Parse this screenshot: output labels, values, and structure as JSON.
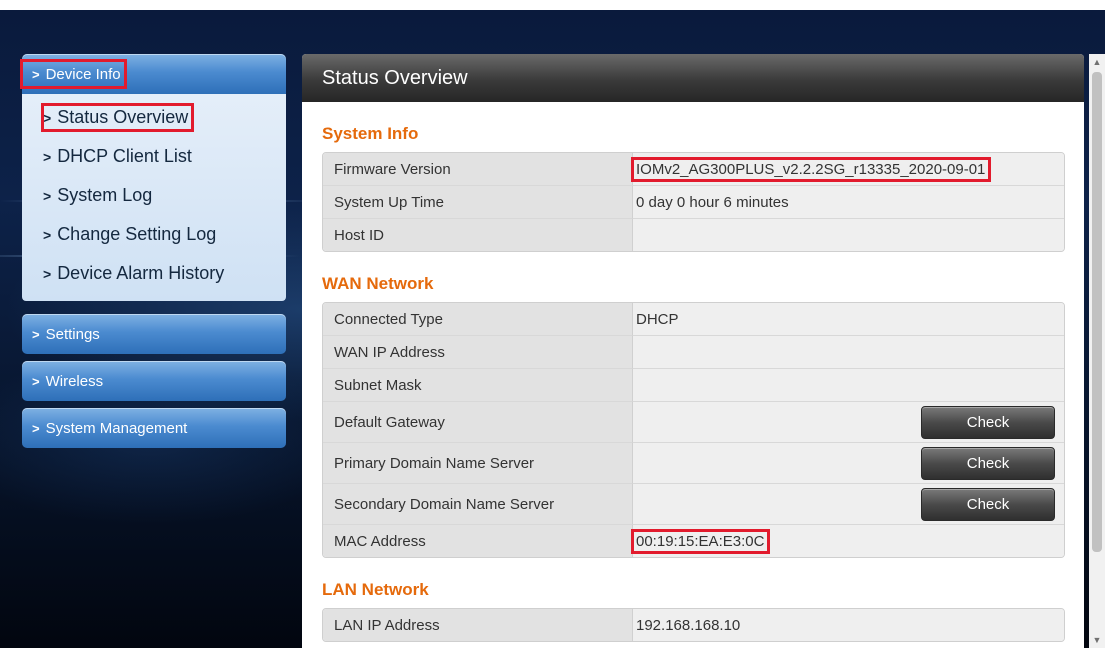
{
  "menu": {
    "device_info": "Device Info",
    "sub_items": [
      "Status Overview",
      "DHCP Client List",
      "System Log",
      "Change Setting Log",
      "Device Alarm History"
    ],
    "settings": "Settings",
    "wireless": "Wireless",
    "system_management": "System Management"
  },
  "panel": {
    "title": "Status Overview",
    "system_info": {
      "title": "System Info",
      "rows": [
        {
          "label": "Firmware Version",
          "value": "IOMv2_AG300PLUS_v2.2.2SG_r13335_2020-09-01"
        },
        {
          "label": "System Up Time",
          "value": "0 day 0 hour 6 minutes"
        },
        {
          "label": "Host ID",
          "value": ""
        }
      ]
    },
    "wan": {
      "title": "WAN Network",
      "rows": [
        {
          "label": "Connected Type",
          "value": "DHCP"
        },
        {
          "label": "WAN IP Address",
          "value": ""
        },
        {
          "label": "Subnet Mask",
          "value": ""
        },
        {
          "label": "Default Gateway",
          "value": ""
        },
        {
          "label": "Primary Domain Name Server",
          "value": ""
        },
        {
          "label": "Secondary Domain Name Server",
          "value": ""
        },
        {
          "label": "MAC Address",
          "value": "00:19:15:EA:E3:0C"
        }
      ],
      "check_label": "Check"
    },
    "lan": {
      "title": "LAN Network",
      "rows": [
        {
          "label": "LAN IP Address",
          "value": "192.168.168.10"
        }
      ]
    }
  },
  "colors": {
    "accent_orange": "#e56a0c",
    "highlight_red": "#e21b2d",
    "menu_blue": "#4b8bd0"
  }
}
